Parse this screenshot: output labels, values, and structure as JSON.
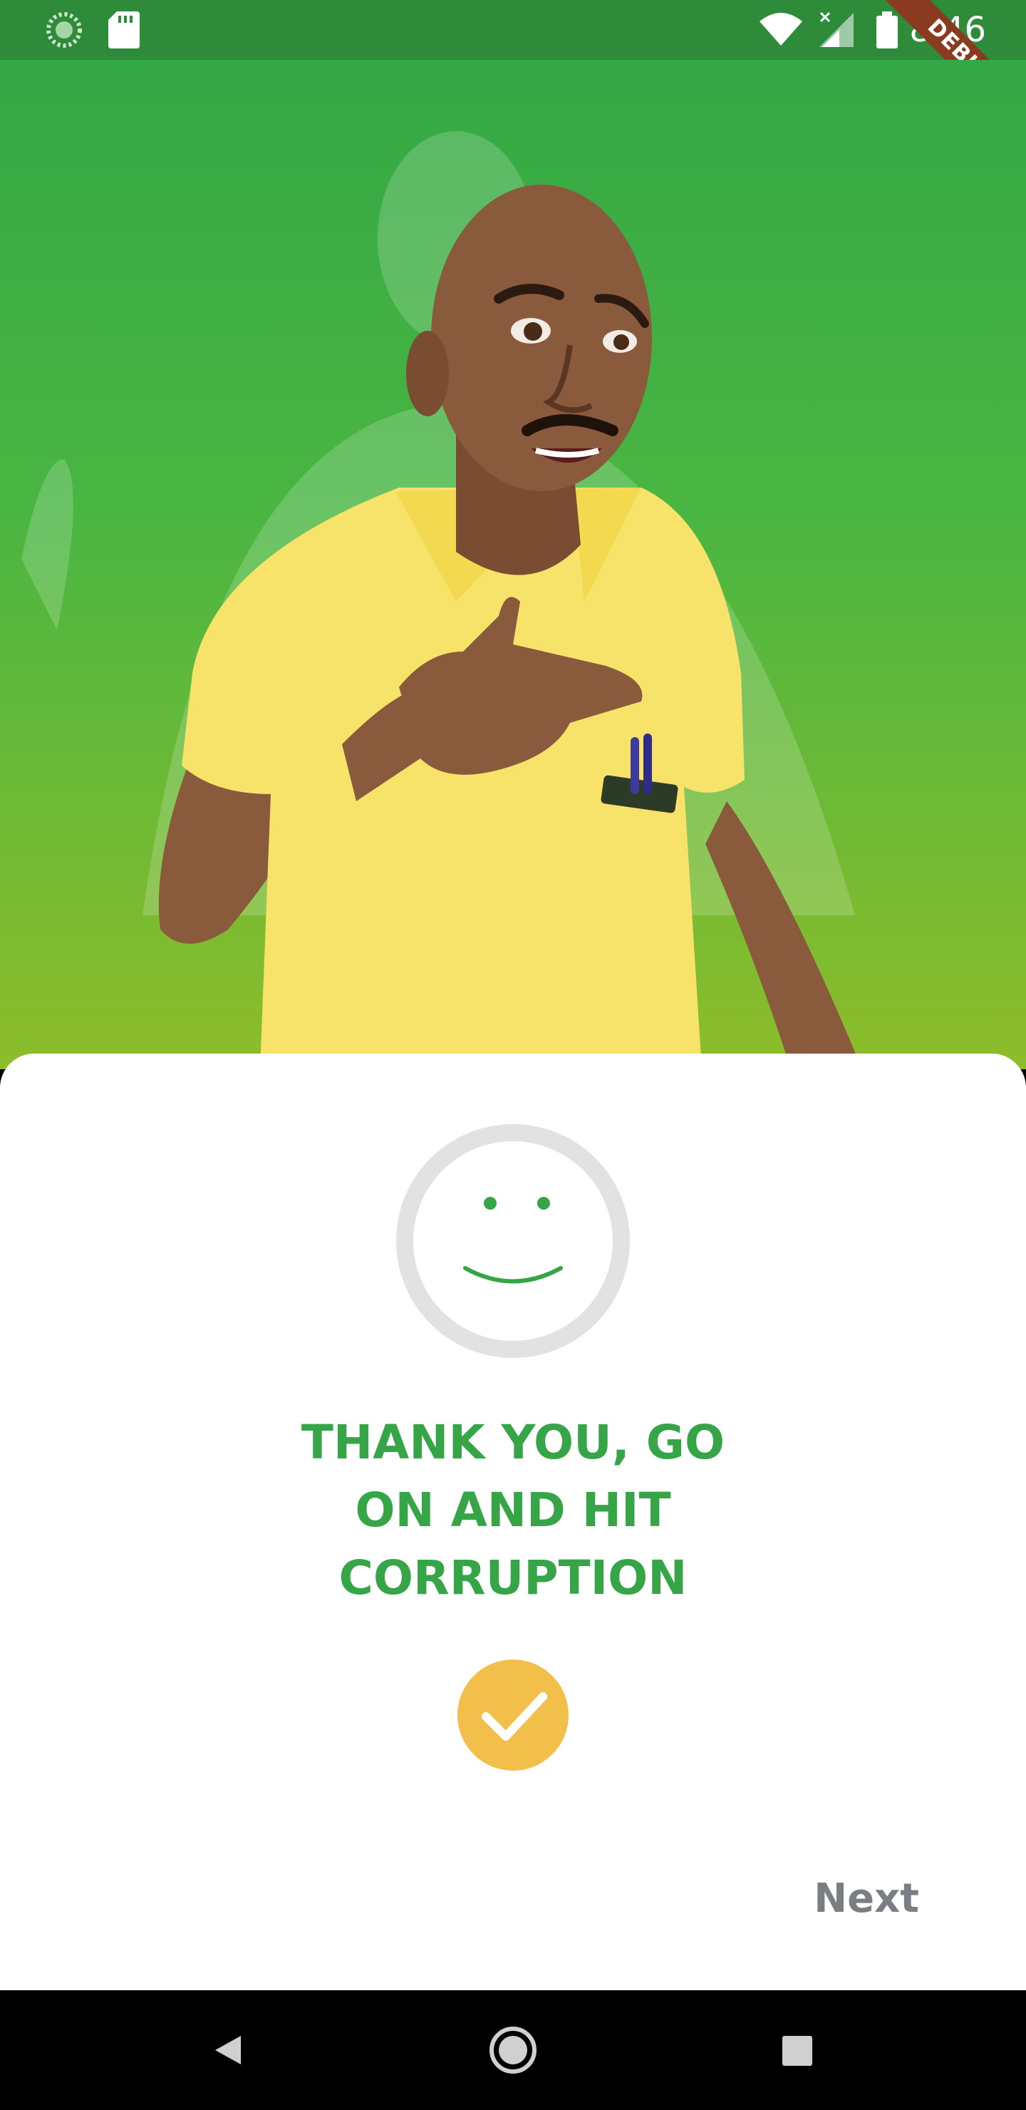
{
  "status_bar": {
    "time": "8:46",
    "left_icons": [
      "sync-icon",
      "sd-card-icon"
    ],
    "right_icons": [
      "wifi-icon",
      "signal-icon",
      "battery-icon"
    ]
  },
  "debug_banner": {
    "label": "DEBUG",
    "color": "#8a3a1f"
  },
  "hero": {
    "illustration": "3d-avatar-man-yellow-shirt-hand-on-chest",
    "gradient_top": "#34a845",
    "gradient_bottom": "#8dbd2a"
  },
  "card": {
    "icon": "smiley-face-icon",
    "message_lines": [
      "THANK YOU, GO",
      "ON AND HIT",
      "CORRUPTION"
    ],
    "message_color": "#36a547",
    "check_icon": "check-circle-icon",
    "check_color": "#f2c04a",
    "next_label": "Next"
  },
  "nav_bar": {
    "buttons": [
      "back-icon",
      "home-icon",
      "recents-icon"
    ]
  }
}
